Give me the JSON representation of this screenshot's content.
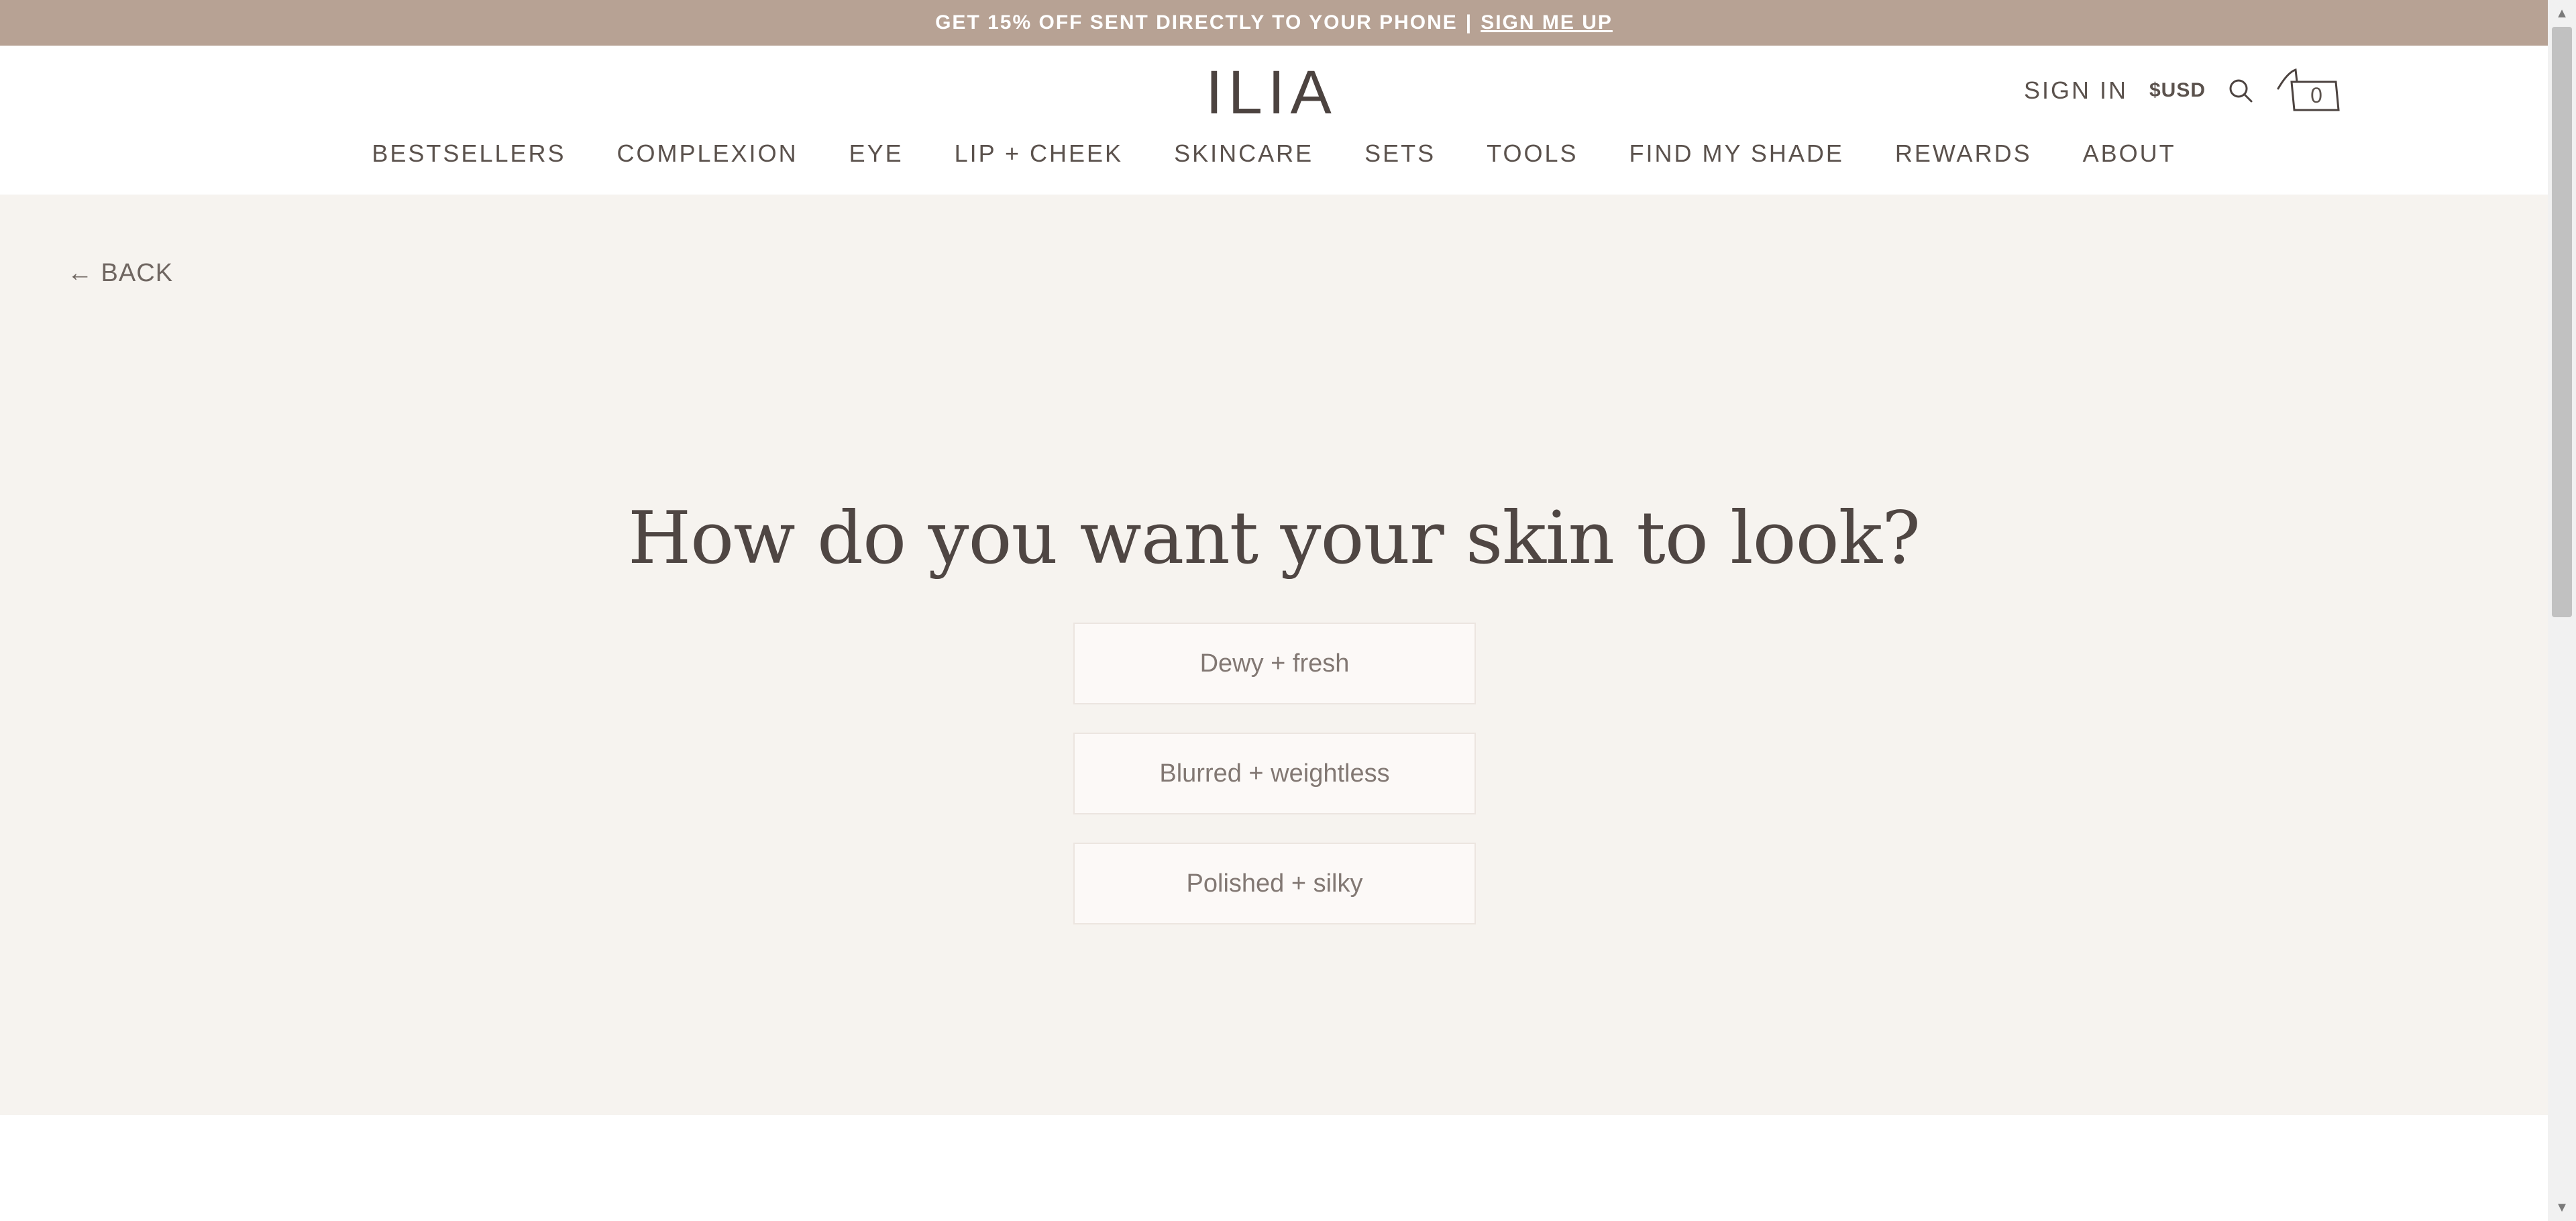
{
  "promo": {
    "text": "GET 15% OFF SENT DIRECTLY TO YOUR PHONE",
    "separator": "|",
    "link": "SIGN ME UP",
    "color": "#b7a294"
  },
  "header": {
    "logo": "ILIA",
    "sign_in": "SIGN IN",
    "currency": "$USD",
    "search_icon": "search-icon",
    "cart_icon": "shopping-bag-icon",
    "cart_count": "0"
  },
  "nav": {
    "items": [
      "BESTSELLERS",
      "COMPLEXION",
      "EYE",
      "LIP + CHEEK",
      "SKINCARE",
      "SETS",
      "TOOLS",
      "FIND MY SHADE",
      "REWARDS",
      "ABOUT"
    ]
  },
  "quiz": {
    "back": "← BACK",
    "question": "How do you want your skin to look?",
    "options": [
      "Dewy + fresh",
      "Blurred + weightless",
      "Polished + silky"
    ],
    "background": "#f6f3ef"
  }
}
